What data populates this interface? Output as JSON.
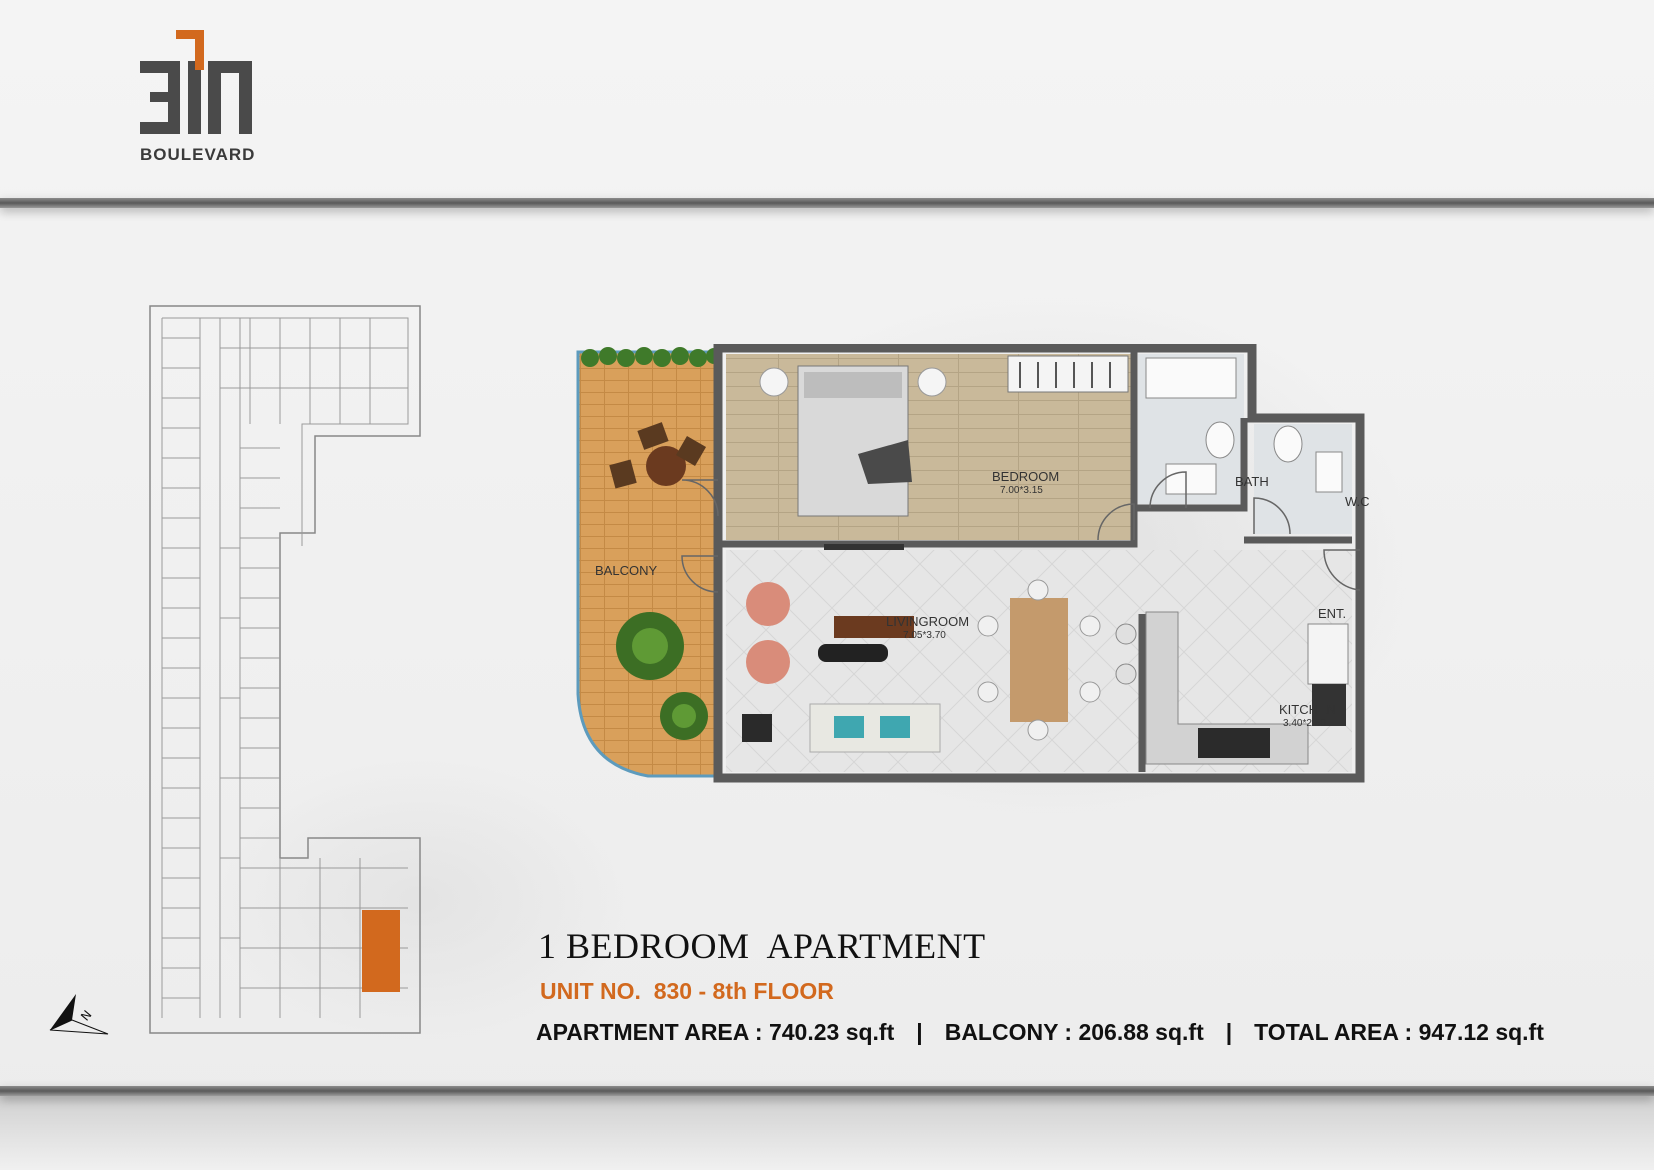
{
  "brand": {
    "logo_text": "311",
    "wordmark": "BOULEVARD"
  },
  "colors": {
    "accent_orange": "#d2691e",
    "balcony_deck": "#d9a05b",
    "wall": "#5a5a5a",
    "band": "#6b6b6b"
  },
  "plan": {
    "rooms": [
      {
        "id": "bedroom",
        "label": "BEDROOM",
        "dims": "7.00*3.15"
      },
      {
        "id": "bath",
        "label": "BATH",
        "dims": ""
      },
      {
        "id": "wc",
        "label": "W.C",
        "dims": ""
      },
      {
        "id": "balcony",
        "label": "BALCONY",
        "dims": ""
      },
      {
        "id": "living",
        "label": "LIVINGROOM",
        "dims": "7.05*3.70"
      },
      {
        "id": "entrance",
        "label": "ENT.",
        "dims": ""
      },
      {
        "id": "kitchen",
        "label": "KITCHEN",
        "dims": "3.40*2.50"
      }
    ]
  },
  "info": {
    "title": "1 BEDROOM  APARTMENT",
    "unit": "UNIT NO.  830 - 8th FLOOR",
    "apartment_area": "APARTMENT AREA : 740.23 sq.ft",
    "balcony_area": "BALCONY : 206.88 sq.ft",
    "total_area": "TOTAL AREA : 947.12 sq.ft",
    "separator": "|"
  },
  "key_plan": {
    "highlighted_unit_color": "#d2691e"
  },
  "north_arrow": {
    "letter": "N"
  }
}
